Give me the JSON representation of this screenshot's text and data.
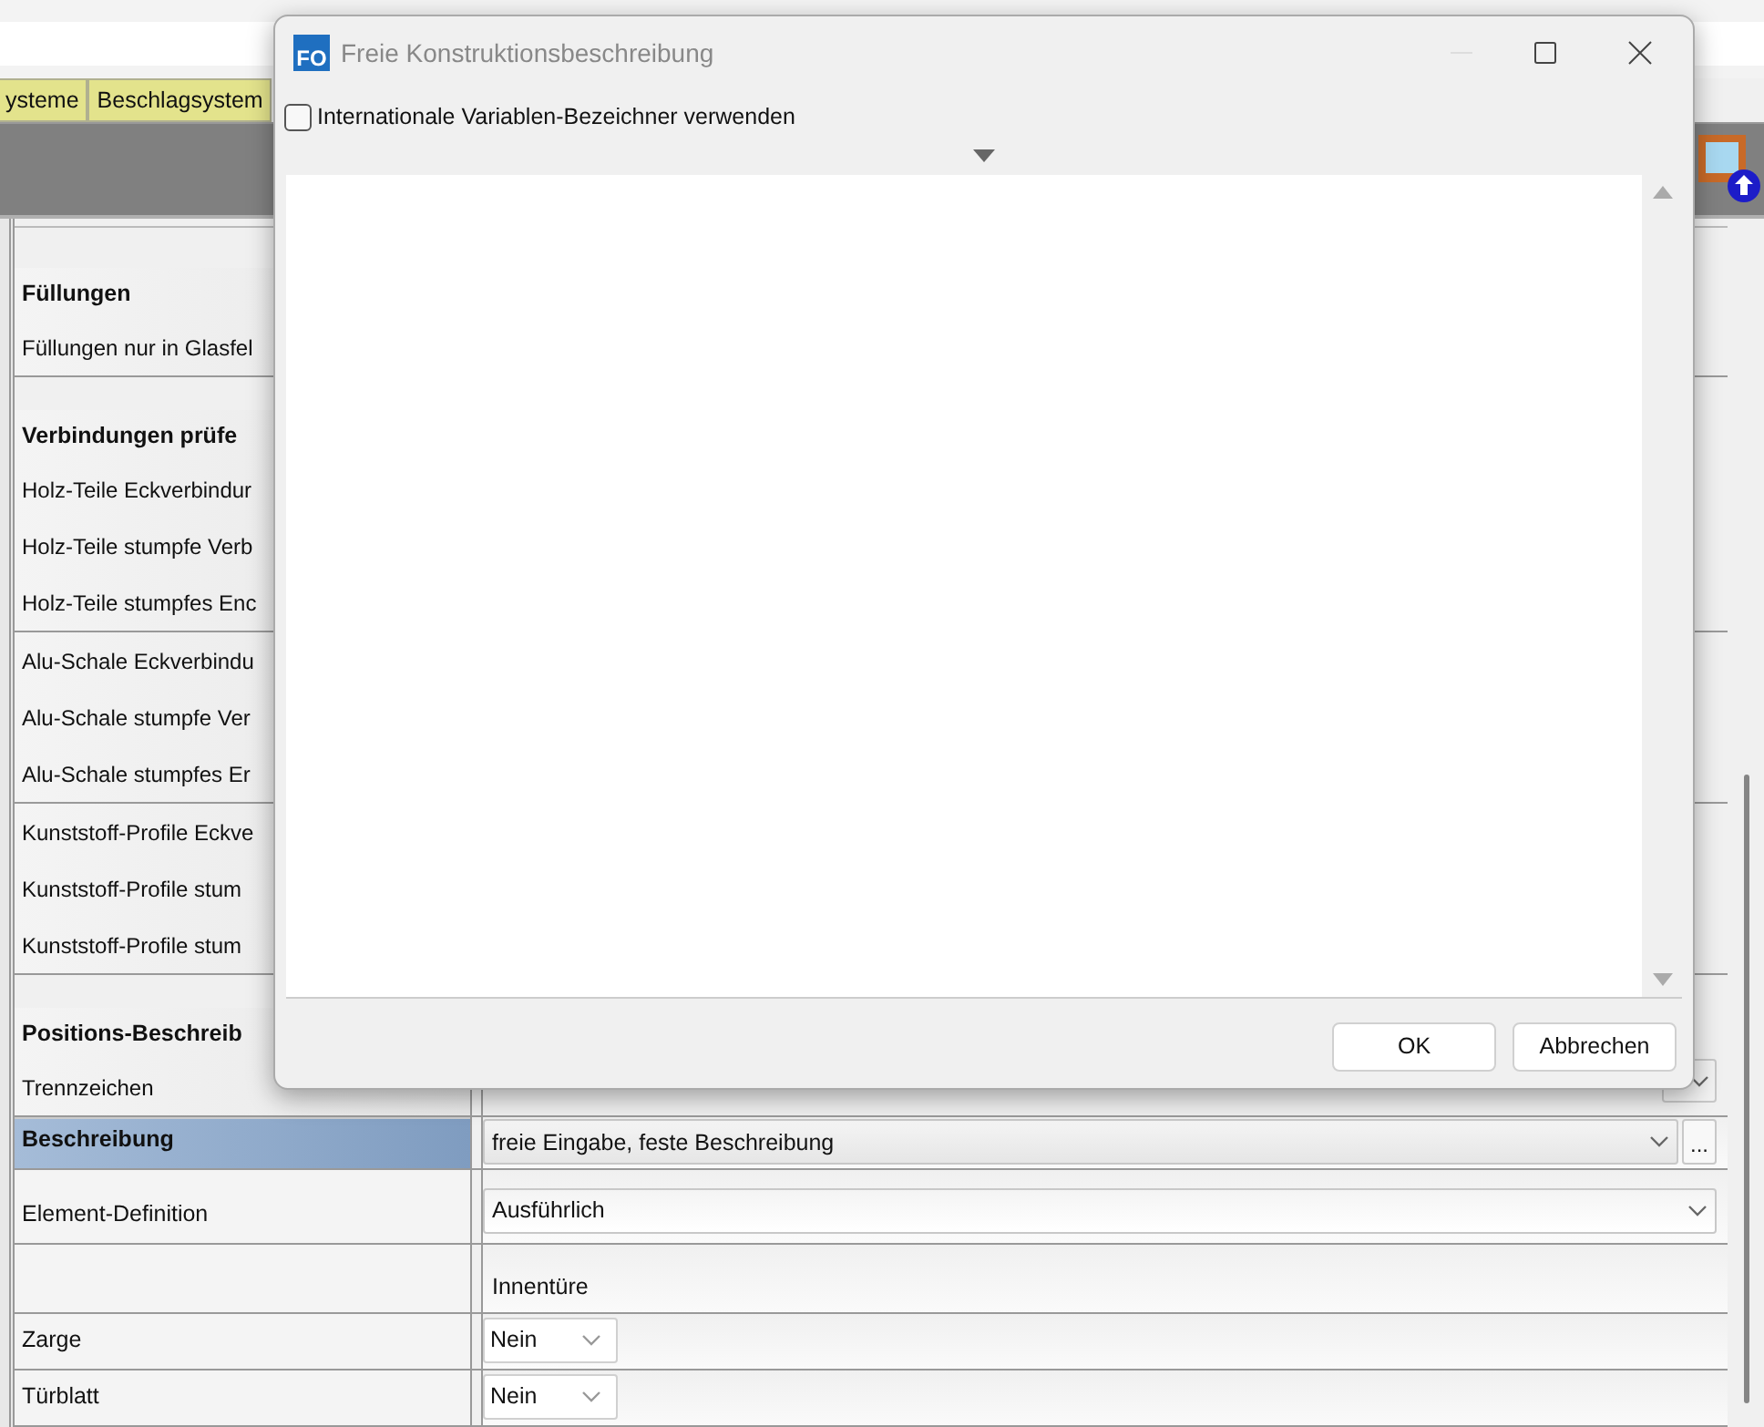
{
  "tabs": [
    {
      "label": "ysteme",
      "selected": false
    },
    {
      "label": "Beschlagsystem",
      "selected": false
    }
  ],
  "groups": [
    {
      "title": "Füllungen",
      "rows": [
        {
          "label": "Füllungen nur in Glasfel"
        }
      ]
    },
    {
      "title": "Verbindungen prüfe",
      "rows": [
        {
          "label": "Holz-Teile Eckverbindur"
        },
        {
          "label": "Holz-Teile stumpfe Verb"
        },
        {
          "label": "Holz-Teile stumpfes Enc"
        }
      ]
    },
    {
      "rows": [
        {
          "label": "Alu-Schale Eckverbindu"
        },
        {
          "label": "Alu-Schale stumpfe Ver"
        },
        {
          "label": "Alu-Schale stumpfes Er"
        }
      ]
    },
    {
      "rows": [
        {
          "label": "Kunststoff-Profile Eckve"
        },
        {
          "label": "Kunststoff-Profile stum"
        },
        {
          "label": "Kunststoff-Profile stum"
        }
      ]
    },
    {
      "title": "Positions-Beschreib",
      "rows": [
        {
          "label": "Trennzeichen",
          "kind": "hidden_dropdown"
        }
      ]
    }
  ],
  "properties": [
    {
      "label": "Beschreibung",
      "selected": true,
      "kind": "dropdown_more",
      "value": "freie Eingabe, feste Beschreibung",
      "more": "..."
    },
    {
      "label": "Element-Definition",
      "selected": false,
      "kind": "dropdown",
      "value": "Ausführlich"
    },
    {
      "selected": false,
      "kind": "caption",
      "value": "Innentüre"
    },
    {
      "label": "Zarge",
      "selected": false,
      "kind": "select",
      "value": "Nein"
    },
    {
      "label": "Türblatt",
      "selected": false,
      "kind": "select",
      "value": "Nein"
    }
  ],
  "dialog": {
    "icon_text": "FO",
    "title": "Freie Konstruktionsbeschreibung",
    "checkbox": {
      "label": "Internationale Variablen-Bezeichner verwenden",
      "checked": false
    },
    "buttons": [
      "OK",
      "Abbrechen"
    ]
  }
}
